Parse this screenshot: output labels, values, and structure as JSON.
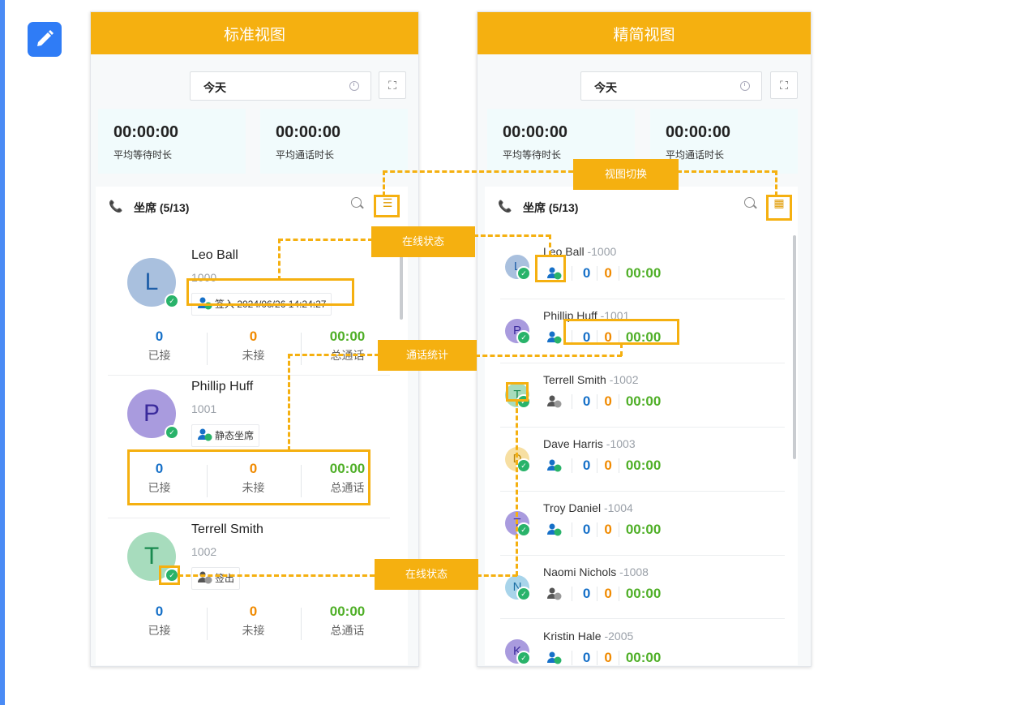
{
  "standard": {
    "title": "标准视图",
    "date_value": "今天",
    "stats": [
      {
        "value": "00:00:00",
        "label": "平均等待时长"
      },
      {
        "value": "00:00:00",
        "label": "平均通话时长"
      }
    ],
    "agents_title": "坐席 (5/13)",
    "agents": [
      {
        "initial": "L",
        "name": "Leo Ball",
        "ext": "1000",
        "chip": "签入 2024/06/26 14:24:27",
        "answered": "0",
        "missed": "0",
        "total": "00:00"
      },
      {
        "initial": "P",
        "name": "Phillip Huff",
        "ext": "1001",
        "chip": "静态坐席",
        "answered": "0",
        "missed": "0",
        "total": "00:00"
      },
      {
        "initial": "T",
        "name": "Terrell Smith",
        "ext": "1002",
        "chip": "签出",
        "answered": "0",
        "missed": "0",
        "total": "00:00"
      }
    ],
    "stat_labels": {
      "answered": "已接",
      "missed": "未接",
      "total": "总通话"
    }
  },
  "compact": {
    "title": "精简视图",
    "date_value": "今天",
    "stats": [
      {
        "value": "00:00:00",
        "label": "平均等待时长"
      },
      {
        "value": "00:00:00",
        "label": "平均通话时长"
      }
    ],
    "agents_title": "坐席 (5/13)",
    "agents": [
      {
        "initial": "L",
        "name": "Leo Ball",
        "ext": "-1000",
        "answered": "0",
        "missed": "0",
        "total": "00:00"
      },
      {
        "initial": "P",
        "name": "Phillip Huff",
        "ext": "-1001",
        "answered": "0",
        "missed": "0",
        "total": "00:00"
      },
      {
        "initial": "T",
        "name": "Terrell Smith",
        "ext": "-1002",
        "answered": "0",
        "missed": "0",
        "total": "00:00"
      },
      {
        "initial": "D",
        "name": "Dave Harris",
        "ext": "-1003",
        "answered": "0",
        "missed": "0",
        "total": "00:00"
      },
      {
        "initial": "T",
        "name": "Troy Daniel",
        "ext": "-1004",
        "answered": "0",
        "missed": "0",
        "total": "00:00"
      },
      {
        "initial": "N",
        "name": "Naomi Nichols",
        "ext": "-1008",
        "answered": "0",
        "missed": "0",
        "total": "00:00"
      },
      {
        "initial": "K",
        "name": "Kristin Hale",
        "ext": "-2005",
        "answered": "0",
        "missed": "0",
        "total": "00:00"
      }
    ]
  },
  "annotations": {
    "view_switch": "视图切换",
    "online_status_1": "在线状态",
    "call_stats": "通话统计",
    "online_status_2": "在线状态"
  },
  "colors": {
    "accent": "#f5b010",
    "answered": "#1670c8",
    "missed": "#f08a00",
    "total": "#4faf27",
    "online": "#29b36a"
  }
}
